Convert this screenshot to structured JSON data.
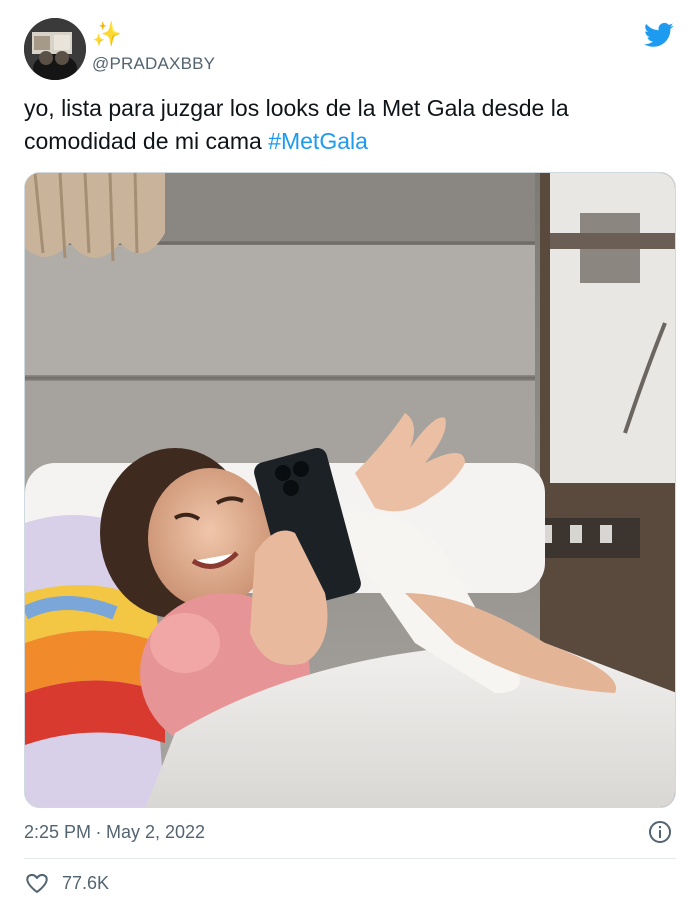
{
  "tweet": {
    "sparkle": "✨",
    "handle": "@PRADAXBBY",
    "text": "yo, lista para juzgar los looks de la Met Gala desde la comodidad de mi cama",
    "hashtag": "#MetGala",
    "time": "2:25 PM",
    "separator": "·",
    "date": "May 2, 2022",
    "likes": "77.6K"
  },
  "colors": {
    "accent": "#1d9bf0",
    "muted": "#536471",
    "text": "#0f1419"
  },
  "icons": [
    "twitter-bird-icon",
    "info-icon",
    "heart-icon"
  ]
}
